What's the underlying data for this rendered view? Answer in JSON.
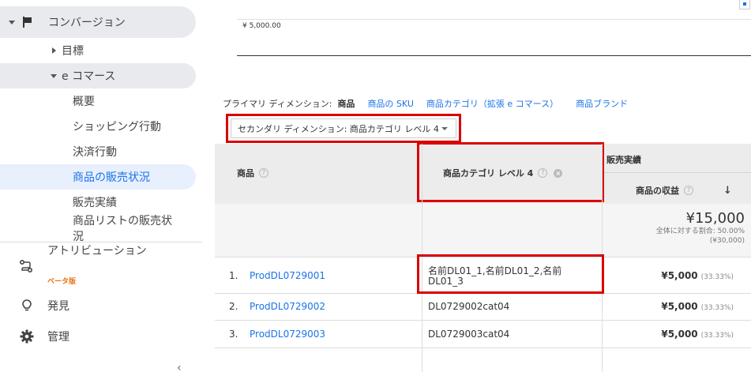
{
  "sidebar": {
    "conversion": "コンバージョン",
    "goals": "目標",
    "ecommerce": "e コマース",
    "sub_items": [
      "概要",
      "ショッピング行動",
      "決済行動",
      "商品の販売状況",
      "販売実績",
      "商品リストの販売状況"
    ],
    "attribution": "アトリビューション",
    "beta": "ベータ版",
    "discover": "発見",
    "admin": "管理"
  },
  "chart": {
    "tick_label": "¥ 5,000.00"
  },
  "dimensions": {
    "label": "プライマリ ディメンション:",
    "current": "商品",
    "options": [
      "商品の SKU",
      "商品カテゴリ（拡張 e コマース）",
      "商品ブランド"
    ]
  },
  "secondary_dimension": "セカンダリ ディメンション: 商品カテゴリ レベル 4",
  "table": {
    "col_product": "商品",
    "col_category": "商品カテゴリ レベル 4",
    "group_header": "販売実績",
    "col_revenue": "商品の収益",
    "total": {
      "value": "¥15,000",
      "share": "全体に対する割合: 50.00%",
      "overall": "(¥30,000)"
    },
    "rows": [
      {
        "index": "1.",
        "product": "ProdDL0729001",
        "category_line1": "名前DL01_1,名前DL01_2,名前",
        "category_line2": "DL01_3",
        "revenue": "¥5,000",
        "pct": "(33.33%)"
      },
      {
        "index": "2.",
        "product": "ProdDL0729002",
        "category_line1": "DL0729002cat04",
        "category_line2": "",
        "revenue": "¥5,000",
        "pct": "(33.33%)"
      },
      {
        "index": "3.",
        "product": "ProdDL0729003",
        "category_line1": "DL0729003cat04",
        "category_line2": "",
        "revenue": "¥5,000",
        "pct": "(33.33%)"
      }
    ]
  },
  "colors": {
    "accent": "#1a73e8",
    "highlight_box": "#d90000",
    "beta": "#e8710a"
  }
}
